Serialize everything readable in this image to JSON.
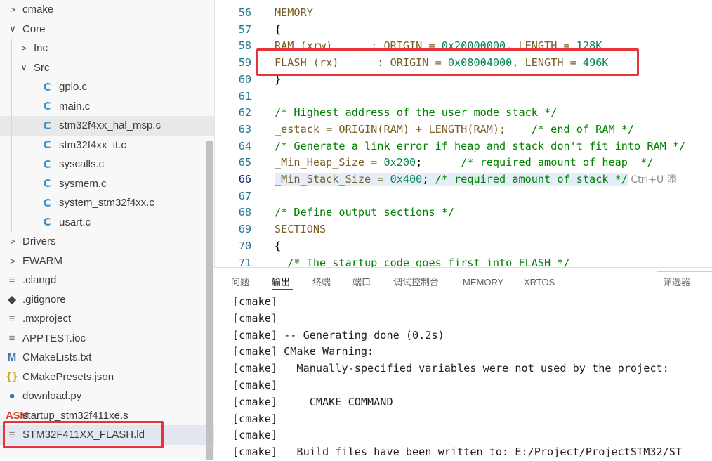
{
  "explorer": {
    "items": [
      {
        "label": "cmake",
        "kind": "folder",
        "state": "collapsed",
        "depth": 0
      },
      {
        "label": "Core",
        "kind": "folder",
        "state": "expanded",
        "depth": 0
      },
      {
        "label": "Inc",
        "kind": "folder",
        "state": "collapsed",
        "depth": 1
      },
      {
        "label": "Src",
        "kind": "folder",
        "state": "expanded",
        "depth": 1
      },
      {
        "label": "gpio.c",
        "kind": "c",
        "depth": 2
      },
      {
        "label": "main.c",
        "kind": "c",
        "depth": 2
      },
      {
        "label": "stm32f4xx_hal_msp.c",
        "kind": "c",
        "depth": 2
      },
      {
        "label": "stm32f4xx_it.c",
        "kind": "c",
        "depth": 2
      },
      {
        "label": "syscalls.c",
        "kind": "c",
        "depth": 2
      },
      {
        "label": "sysmem.c",
        "kind": "c",
        "depth": 2
      },
      {
        "label": "system_stm32f4xx.c",
        "kind": "c",
        "depth": 2
      },
      {
        "label": "usart.c",
        "kind": "c",
        "depth": 2
      },
      {
        "label": "Drivers",
        "kind": "folder",
        "state": "collapsed",
        "depth": 0
      },
      {
        "label": "EWARM",
        "kind": "folder",
        "state": "collapsed",
        "depth": 0
      },
      {
        "label": ".clangd",
        "kind": "lines",
        "depth": 0
      },
      {
        "label": ".gitignore",
        "kind": "git",
        "depth": 0
      },
      {
        "label": ".mxproject",
        "kind": "lines",
        "depth": 0
      },
      {
        "label": "APPTEST.ioc",
        "kind": "lines",
        "depth": 0
      },
      {
        "label": "CMakeLists.txt",
        "kind": "cmake",
        "depth": 0
      },
      {
        "label": "CMakePresets.json",
        "kind": "json",
        "depth": 0
      },
      {
        "label": "download.py",
        "kind": "python",
        "depth": 0
      },
      {
        "label": "startup_stm32f411xe.s",
        "kind": "asm",
        "depth": 0
      },
      {
        "label": "STM32F411XX_FLASH.ld",
        "kind": "lines",
        "depth": 0,
        "selected": true
      }
    ],
    "icons": {
      "c": "C",
      "folder_collapsed": ">",
      "folder_expanded": "∨",
      "asm": "ASM",
      "cmake": "M",
      "json": "{}"
    }
  },
  "editor": {
    "lines": [
      {
        "n": "56",
        "tokens": [
          [
            "MEMORY",
            "ident"
          ]
        ]
      },
      {
        "n": "57",
        "tokens": [
          [
            "{",
            "op"
          ]
        ]
      },
      {
        "n": "58",
        "tokens": [
          [
            "RAM (xrw)      : ORIGIN = ",
            "ident"
          ],
          [
            "0x20000000",
            "num"
          ],
          [
            ", LENGTH = ",
            "ident"
          ],
          [
            "128K",
            "num"
          ]
        ]
      },
      {
        "n": "59",
        "tokens": [
          [
            "FLASH (rx)      : ORIGIN = ",
            "ident"
          ],
          [
            "0x08004000",
            "num"
          ],
          [
            ", LENGTH = ",
            "ident"
          ],
          [
            "496K",
            "num"
          ]
        ]
      },
      {
        "n": "60",
        "tokens": [
          [
            "}",
            "op"
          ]
        ]
      },
      {
        "n": "61",
        "tokens": []
      },
      {
        "n": "62",
        "tokens": [
          [
            "/* Highest address of the user mode stack */",
            "cm"
          ]
        ]
      },
      {
        "n": "63",
        "tokens": [
          [
            "_estack = ORIGIN(RAM) + LENGTH(RAM);    ",
            "ident"
          ],
          [
            "/* end of RAM */",
            "cm"
          ]
        ]
      },
      {
        "n": "64",
        "tokens": [
          [
            "/* Generate a link error if heap and stack don't fit into RAM */",
            "cm"
          ]
        ]
      },
      {
        "n": "65",
        "tokens": [
          [
            "_Min_Heap_Size = ",
            "ident"
          ],
          [
            "0x200",
            "num"
          ],
          [
            ";      ",
            "op"
          ],
          [
            "/* required amount of heap  */",
            "cm"
          ]
        ]
      },
      {
        "n": "66",
        "current": true,
        "tokens": [
          [
            "_Min_Stack_Size = ",
            "ident"
          ],
          [
            "0x400",
            "num"
          ],
          [
            "; ",
            "op"
          ],
          [
            "/* required amount of stack */",
            "cm"
          ]
        ],
        "hint": " Ctrl+U 添"
      },
      {
        "n": "67",
        "tokens": []
      },
      {
        "n": "68",
        "tokens": [
          [
            "/* Define output sections */",
            "cm"
          ]
        ]
      },
      {
        "n": "69",
        "tokens": [
          [
            "SECTIONS",
            "ident"
          ]
        ]
      },
      {
        "n": "70",
        "tokens": [
          [
            "{",
            "op"
          ]
        ]
      },
      {
        "n": "71",
        "tokens": [
          [
            "  /* The startup code goes first into FLASH */",
            "cm"
          ]
        ]
      }
    ]
  },
  "panel": {
    "tabs": [
      {
        "label": "问题"
      },
      {
        "label": "输出",
        "active": true
      },
      {
        "label": "终端"
      },
      {
        "label": "端口"
      },
      {
        "label": "调试控制台"
      },
      {
        "label": "MEMORY"
      },
      {
        "label": "XRTOS"
      }
    ],
    "filter_placeholder": "筛选器",
    "output": [
      "[cmake] ",
      "[cmake]",
      "[cmake] -- Generating done (0.2s)",
      "[cmake] CMake Warning:",
      "[cmake]   Manually-specified variables were not used by the project:",
      "[cmake]",
      "[cmake]     CMAKE_COMMAND",
      "[cmake]",
      "[cmake]",
      "[cmake]   Build files have been written to: E:/Project/ProjectSTM32/ST"
    ]
  }
}
